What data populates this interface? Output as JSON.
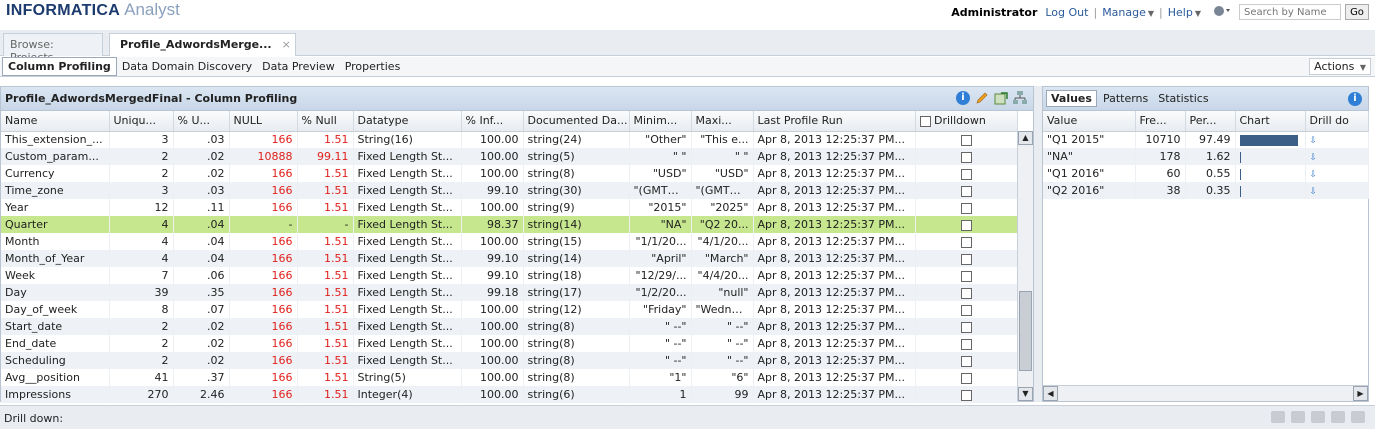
{
  "header": {
    "brand": "INFORMATICA",
    "product": "Analyst",
    "user": "Administrator",
    "logout": "Log Out",
    "manage": "Manage",
    "help": "Help",
    "search_placeholder": "Search by Name",
    "go": "Go"
  },
  "tabs": {
    "browse": "Browse: Projects",
    "profile": "Profile_AdwordsMerge..."
  },
  "subtabs": [
    "Column Profiling",
    "Data Domain Discovery",
    "Data Preview",
    "Properties"
  ],
  "actions": "Actions",
  "left_panel": {
    "title": "Profile_AdwordsMergedFinal - Column Profiling",
    "columns": [
      "Name",
      "Uniqu...",
      "% U...",
      "NULL",
      "% Null",
      "Datatype",
      "% Inf...",
      "Documented Da...",
      "Minim...",
      "Maxi...",
      "Last Profile Run",
      "Drilldown"
    ],
    "rows": [
      [
        "This_extension_...",
        "3",
        ".03",
        "166",
        "1.51",
        "String(16)",
        "100.00",
        "string(24)",
        "\"Other\"",
        "\"This e...",
        "Apr 8, 2013 12:25:37 PM..."
      ],
      [
        "Custom_param...",
        "2",
        ".02",
        "10888",
        "99.11",
        "Fixed Length St...",
        "100.00",
        "string(5)",
        "\" \"",
        "\" \"",
        "Apr 8, 2013 12:25:37 PM..."
      ],
      [
        "Currency",
        "2",
        ".02",
        "166",
        "1.51",
        "Fixed Length St...",
        "100.00",
        "string(8)",
        "\"USD\"",
        "\"USD\"",
        "Apr 8, 2013 12:25:37 PM..."
      ],
      [
        "Time_zone",
        "3",
        ".03",
        "166",
        "1.51",
        "Fixed Length St...",
        "99.10",
        "string(30)",
        "\"(GMT+...",
        "\"(GMT+...",
        "Apr 8, 2013 12:25:37 PM..."
      ],
      [
        "Year",
        "12",
        ".11",
        "166",
        "1.51",
        "Fixed Length St...",
        "100.00",
        "string(9)",
        "\"2015\"",
        "\"2025\"",
        "Apr 8, 2013 12:25:37 PM..."
      ],
      [
        "Quarter",
        "4",
        ".04",
        "-",
        "-",
        "Fixed Length St...",
        "98.37",
        "string(14)",
        "\"NA\"",
        "\"Q2 20...",
        "Apr 8, 2013 12:25:37 PM..."
      ],
      [
        "Month",
        "4",
        ".04",
        "166",
        "1.51",
        "Fixed Length St...",
        "100.00",
        "string(15)",
        "\"1/1/20...",
        "\"4/1/20...",
        "Apr 8, 2013 12:25:37 PM..."
      ],
      [
        "Month_of_Year",
        "4",
        ".04",
        "166",
        "1.51",
        "Fixed Length St...",
        "99.10",
        "string(14)",
        "\"April\"",
        "\"March\"",
        "Apr 8, 2013 12:25:37 PM..."
      ],
      [
        "Week",
        "7",
        ".06",
        "166",
        "1.51",
        "Fixed Length St...",
        "99.10",
        "string(18)",
        "\"12/29/...",
        "\"4/4/20...",
        "Apr 8, 2013 12:25:37 PM..."
      ],
      [
        "Day",
        "39",
        ".35",
        "166",
        "1.51",
        "Fixed Length St...",
        "99.18",
        "string(17)",
        "\"1/2/20...",
        "\"null\"",
        "Apr 8, 2013 12:25:37 PM..."
      ],
      [
        "Day_of_week",
        "8",
        ".07",
        "166",
        "1.51",
        "Fixed Length St...",
        "100.00",
        "string(12)",
        "\"Friday\"",
        "\"Wedne...",
        "Apr 8, 2013 12:25:37 PM..."
      ],
      [
        "Start_date",
        "2",
        ".02",
        "166",
        "1.51",
        "Fixed Length St...",
        "100.00",
        "string(8)",
        "\" --\"",
        "\" --\"",
        "Apr 8, 2013 12:25:37 PM..."
      ],
      [
        "End_date",
        "2",
        ".02",
        "166",
        "1.51",
        "Fixed Length St...",
        "100.00",
        "string(8)",
        "\" --\"",
        "\" --\"",
        "Apr 8, 2013 12:25:37 PM..."
      ],
      [
        "Scheduling",
        "2",
        ".02",
        "166",
        "1.51",
        "Fixed Length St...",
        "100.00",
        "string(8)",
        "\" --\"",
        "\" --\"",
        "Apr 8, 2013 12:25:37 PM..."
      ],
      [
        "Avg__position",
        "41",
        ".37",
        "166",
        "1.51",
        "String(5)",
        "100.00",
        "string(8)",
        "\"1\"",
        "\"6\"",
        "Apr 8, 2013 12:25:37 PM..."
      ],
      [
        "Impressions",
        "270",
        "2.46",
        "166",
        "1.51",
        "Integer(4)",
        "100.00",
        "string(6)",
        "1",
        "99",
        "Apr 8, 2013 12:25:37 PM..."
      ]
    ],
    "selected_row_index": 5
  },
  "right_panel": {
    "tabs": [
      "Values",
      "Patterns",
      "Statistics"
    ],
    "columns": [
      "Value",
      "Fre...",
      "Per...",
      "Chart",
      "Drill do"
    ],
    "rows": [
      {
        "value": "\"Q1 2015\"",
        "freq": "10710",
        "pct": "97.49",
        "share": 0.9749
      },
      {
        "value": "\"NA\"",
        "freq": "178",
        "pct": "1.62",
        "share": 0.0162
      },
      {
        "value": "\"Q1 2016\"",
        "freq": "60",
        "pct": "0.55",
        "share": 0.0055
      },
      {
        "value": "\"Q2 2016\"",
        "freq": "38",
        "pct": "0.35",
        "share": 0.0035
      }
    ]
  },
  "bottom": {
    "drill_label": "Drill down:"
  },
  "colors": {
    "selected_row": "#c6e78e",
    "alt_row": "#eef2f7",
    "null_red": "#e0201b",
    "chart_bar": "#3b5f86"
  }
}
